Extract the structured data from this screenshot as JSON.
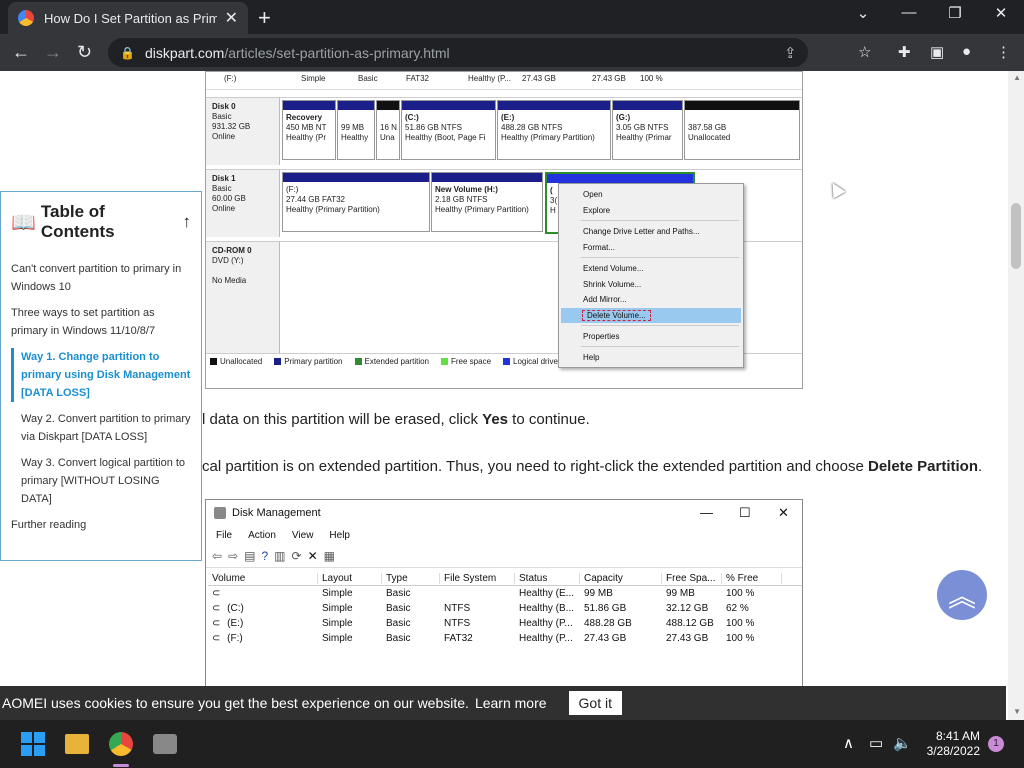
{
  "browser": {
    "tab_title": "How Do I Set Partition as Primary",
    "url_host": "diskpart.com",
    "url_path": "/articles/set-partition-as-primary.html"
  },
  "screenshot1": {
    "top_row": [
      "(F:)",
      "Simple",
      "Basic",
      "FAT32",
      "Healthy (P...",
      "27.43 GB",
      "27.43 GB",
      "100 %"
    ],
    "disk0": {
      "name": "Disk 0",
      "type": "Basic",
      "size": "931.32 GB",
      "status": "Online",
      "parts": [
        {
          "name": "Recovery",
          "l2": "450 MB NT",
          "l3": "Healthy (Pr"
        },
        {
          "name": "",
          "l2": "99 MB",
          "l3": "Healthy"
        },
        {
          "name": "",
          "l2": "16 N",
          "l3": "Una"
        },
        {
          "name": "(C:)",
          "l2": "51.86 GB NTFS",
          "l3": "Healthy (Boot, Page Fi"
        },
        {
          "name": "(E:)",
          "l2": "488.28 GB NTFS",
          "l3": "Healthy (Primary Partition)"
        },
        {
          "name": "(G:)",
          "l2": "3.05 GB NTFS",
          "l3": "Healthy (Primar"
        },
        {
          "name": "",
          "l2": "387.58 GB",
          "l3": "Unallocated"
        }
      ]
    },
    "disk1": {
      "name": "Disk 1",
      "type": "Basic",
      "size": "60.00 GB",
      "status": "Online",
      "parts": [
        {
          "name": "(F:)",
          "l2": "27.44 GB FAT32",
          "l3": "Healthy (Primary Partition)"
        },
        {
          "name": "New Volume  (H:)",
          "l2": "2.18 GB NTFS",
          "l3": "Healthy (Primary Partition)"
        },
        {
          "name": "(",
          "l2": "3(",
          "l3": "H"
        }
      ]
    },
    "cdrom": {
      "name": "CD-ROM 0",
      "type": "DVD (Y:)",
      "status": "No Media"
    },
    "legend": [
      "Unallocated",
      "Primary partition",
      "Extended partition",
      "Free space",
      "Logical drive"
    ],
    "legend_colors": [
      "#111111",
      "#1a1f8a",
      "#2e8b2e",
      "#66dd44",
      "#2233dd"
    ],
    "context_menu": [
      "Open",
      "Explore",
      "Change Drive Letter and Paths...",
      "Format...",
      "Extend Volume...",
      "Shrink Volume...",
      "Add Mirror...",
      "Delete Volume...",
      "Properties",
      "Help"
    ]
  },
  "toc": {
    "title": "Table of Contents",
    "items": [
      "Can't convert partition to primary in Windows 10",
      "Three ways to set partition as primary in Windows 11/10/8/7",
      "Way 1. Change partition to primary using Disk Management [DATA LOSS]",
      "Way 2. Convert partition to primary via Diskpart [DATA LOSS]",
      "Way 3. Convert logical partition to primary [WITHOUT LOSING DATA]",
      "Further reading"
    ]
  },
  "article": {
    "p1_pre": "l data on this partition will be erased, click ",
    "p1_bold": "Yes",
    "p1_post": " to continue.",
    "p2_pre": "cal partition is on extended partition. Thus, you need to right-click the extended partition and choose ",
    "p2_bold": "Delete Partition",
    "p2_post": "."
  },
  "screenshot2": {
    "title": "Disk Management",
    "menu": [
      "File",
      "Action",
      "View",
      "Help"
    ],
    "headers": [
      "Volume",
      "Layout",
      "Type",
      "File System",
      "Status",
      "Capacity",
      "Free Spa...",
      "% Free"
    ],
    "rows": [
      [
        "",
        "Simple",
        "Basic",
        "",
        "Healthy (E...",
        "99 MB",
        "99 MB",
        "100 %"
      ],
      [
        "(C:)",
        "Simple",
        "Basic",
        "NTFS",
        "Healthy (B...",
        "51.86 GB",
        "32.12 GB",
        "62 %"
      ],
      [
        "(E:)",
        "Simple",
        "Basic",
        "NTFS",
        "Healthy (P...",
        "488.28 GB",
        "488.12 GB",
        "100 %"
      ],
      [
        "(F:)",
        "Simple",
        "Basic",
        "FAT32",
        "Healthy (P...",
        "27.43 GB",
        "27.43 GB",
        "100 %"
      ]
    ]
  },
  "cookie": {
    "text": "AOMEI uses cookies to ensure you get the best experience on our website.",
    "learn_more": "Learn more",
    "button": "Got it"
  },
  "taskbar": {
    "time": "8:41 AM",
    "date": "3/28/2022",
    "notifications": "1"
  }
}
